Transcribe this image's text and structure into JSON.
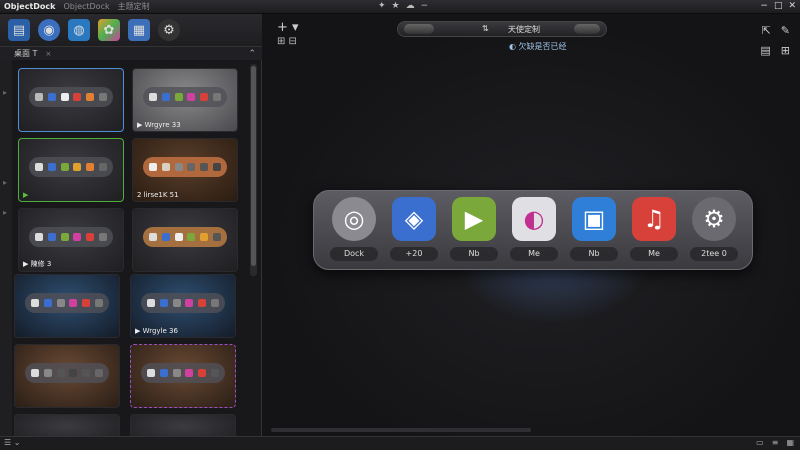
{
  "window": {
    "app_title": "ObjectDock",
    "subtitle": "ObjectDock",
    "mode_label": "主题定制"
  },
  "toolbar": {
    "icons": [
      "dock-icon",
      "globe-icon",
      "paint-icon",
      "palette-icon",
      "grid-icon",
      "gear-icon"
    ]
  },
  "panel": {
    "header_label": "桌面 T",
    "close_glyph": "×"
  },
  "thumbnails": [
    {
      "label": "",
      "style": "selected-blue"
    },
    {
      "label": "▶ Wrgyre 33",
      "style": "light"
    },
    {
      "label": "▶",
      "style": "selected-green"
    },
    {
      "label": "2 lirse1K 51",
      "style": "wood"
    },
    {
      "label": "▶ 陳修 3",
      "style": "dark"
    },
    {
      "label": "",
      "style": "tan"
    },
    {
      "label": "",
      "style": "blue-scene"
    },
    {
      "label": "▶ Wrgyle 36",
      "style": "blue-scene"
    },
    {
      "label": "",
      "style": "warm-scene"
    },
    {
      "label": "",
      "style": "warm-selected"
    }
  ],
  "main": {
    "add_glyph": "+ ▾",
    "slider_label": "天使定制",
    "slider_icon": "⇅",
    "status_text": "欠缺是否已经",
    "preview_dock": {
      "items": [
        {
          "label": "Dock",
          "icon": "disc-icon",
          "color": "#8a8a90"
        },
        {
          "label": "+20",
          "icon": "glass-icon",
          "color": "#3a6fd0"
        },
        {
          "label": "Nb",
          "icon": "play-icon",
          "color": "#7aa83a"
        },
        {
          "label": "Me",
          "icon": "browser-icon",
          "color": "#e0e0e4"
        },
        {
          "label": "Nb",
          "icon": "book-icon",
          "color": "#2f7fd8"
        },
        {
          "label": "Me",
          "icon": "music-icon",
          "color": "#d8403a"
        },
        {
          "label": "2tee 0",
          "icon": "gear-icon",
          "color": "#6a6a70"
        }
      ]
    }
  },
  "colors": {
    "accent_blue": "#4f8fd6",
    "accent_green": "#4fae3a",
    "accent_purple": "#9a4fc4"
  }
}
